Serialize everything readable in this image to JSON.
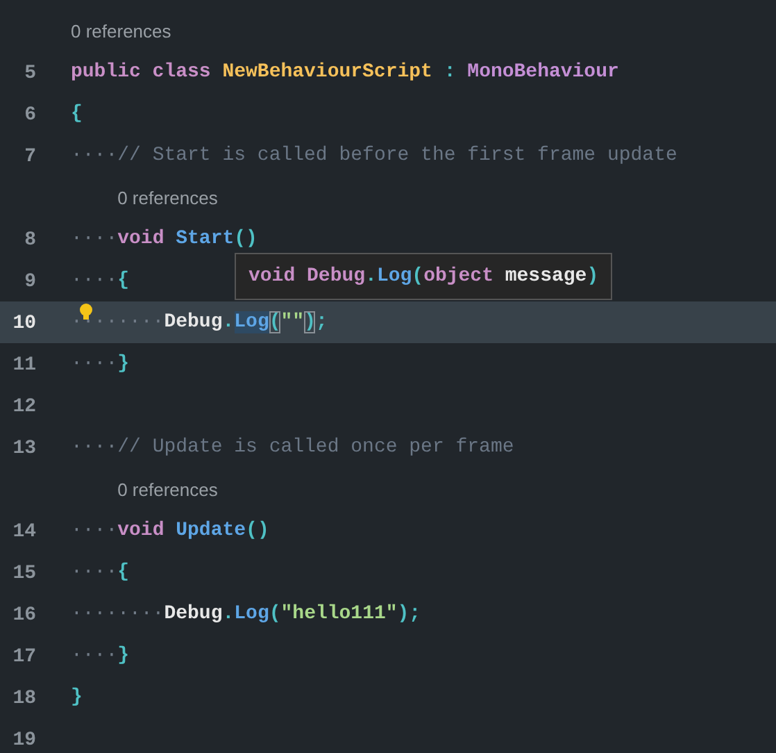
{
  "editor": {
    "rows": [
      {
        "kind": "lens",
        "text": "0 references"
      },
      {
        "kind": "code",
        "number": "5",
        "current": false,
        "tokens": [
          {
            "kind": "kw",
            "text": "public class "
          },
          {
            "kind": "cls",
            "text": "NewBehaviourScript"
          },
          {
            "kind": "punct",
            "text": " : "
          },
          {
            "kind": "type",
            "text": "MonoBehaviour"
          }
        ]
      },
      {
        "kind": "code",
        "number": "6",
        "current": false,
        "tokens": [
          {
            "kind": "punct",
            "text": "{"
          }
        ]
      },
      {
        "kind": "code",
        "number": "7",
        "current": false,
        "tokens": [
          {
            "kind": "ws",
            "text": "····"
          },
          {
            "kind": "comment",
            "text": "// Start is called before the first frame update"
          }
        ]
      },
      {
        "kind": "memberlens",
        "text": "0 references"
      },
      {
        "kind": "code",
        "number": "8",
        "current": false,
        "tokens": [
          {
            "kind": "ws",
            "text": "····"
          },
          {
            "kind": "kw",
            "text": "void "
          },
          {
            "kind": "method",
            "text": "Start"
          },
          {
            "kind": "punct",
            "text": "()"
          }
        ]
      },
      {
        "kind": "code",
        "number": "9",
        "current": false,
        "tokens": [
          {
            "kind": "ws",
            "text": "····"
          },
          {
            "kind": "punct",
            "text": "{"
          }
        ]
      },
      {
        "kind": "code",
        "number": "10",
        "current": true,
        "lightbulb": true,
        "tokens": [
          {
            "kind": "ws",
            "text": "········"
          },
          {
            "kind": "ident",
            "text": "Debug"
          },
          {
            "kind": "punct",
            "text": "."
          },
          {
            "kind": "selmethod",
            "text": "Log"
          },
          {
            "kind": "bracket",
            "text": "("
          },
          {
            "kind": "string",
            "text": "\"\""
          },
          {
            "kind": "bracket",
            "text": ")"
          },
          {
            "kind": "punct",
            "text": ";"
          }
        ]
      },
      {
        "kind": "code",
        "number": "11",
        "current": false,
        "tokens": [
          {
            "kind": "ws",
            "text": "····"
          },
          {
            "kind": "punct",
            "text": "}"
          }
        ]
      },
      {
        "kind": "code",
        "number": "12",
        "current": false,
        "tokens": []
      },
      {
        "kind": "code",
        "number": "13",
        "current": false,
        "tokens": [
          {
            "kind": "ws",
            "text": "····"
          },
          {
            "kind": "comment",
            "text": "// Update is called once per frame"
          }
        ]
      },
      {
        "kind": "memberlens",
        "text": "0 references"
      },
      {
        "kind": "code",
        "number": "14",
        "current": false,
        "tokens": [
          {
            "kind": "ws",
            "text": "····"
          },
          {
            "kind": "kw",
            "text": "void "
          },
          {
            "kind": "method",
            "text": "Update"
          },
          {
            "kind": "punct",
            "text": "()"
          }
        ]
      },
      {
        "kind": "code",
        "number": "15",
        "current": false,
        "tokens": [
          {
            "kind": "ws",
            "text": "····"
          },
          {
            "kind": "punct",
            "text": "{"
          }
        ]
      },
      {
        "kind": "code",
        "number": "16",
        "current": false,
        "tokens": [
          {
            "kind": "ws",
            "text": "········"
          },
          {
            "kind": "ident",
            "text": "Debug"
          },
          {
            "kind": "punct",
            "text": "."
          },
          {
            "kind": "method",
            "text": "Log"
          },
          {
            "kind": "punct",
            "text": "("
          },
          {
            "kind": "string",
            "text": "\"hello111\""
          },
          {
            "kind": "punct",
            "text": ");"
          }
        ]
      },
      {
        "kind": "code",
        "number": "17",
        "current": false,
        "tokens": [
          {
            "kind": "ws",
            "text": "····"
          },
          {
            "kind": "punct",
            "text": "}"
          }
        ]
      },
      {
        "kind": "code",
        "number": "18",
        "current": false,
        "tokens": [
          {
            "kind": "punct",
            "text": "}"
          }
        ]
      },
      {
        "kind": "code",
        "number": "19",
        "current": false,
        "tokens": []
      }
    ]
  },
  "tooltip": {
    "tokens": [
      {
        "kind": "kw",
        "text": "void "
      },
      {
        "kind": "kw",
        "text": "Debug"
      },
      {
        "kind": "punct",
        "text": "."
      },
      {
        "kind": "method",
        "text": "Log"
      },
      {
        "kind": "punct",
        "text": "("
      },
      {
        "kind": "kw",
        "text": "object "
      },
      {
        "kind": "ident",
        "text": "message"
      },
      {
        "kind": "punct",
        "text": ")"
      }
    ]
  }
}
